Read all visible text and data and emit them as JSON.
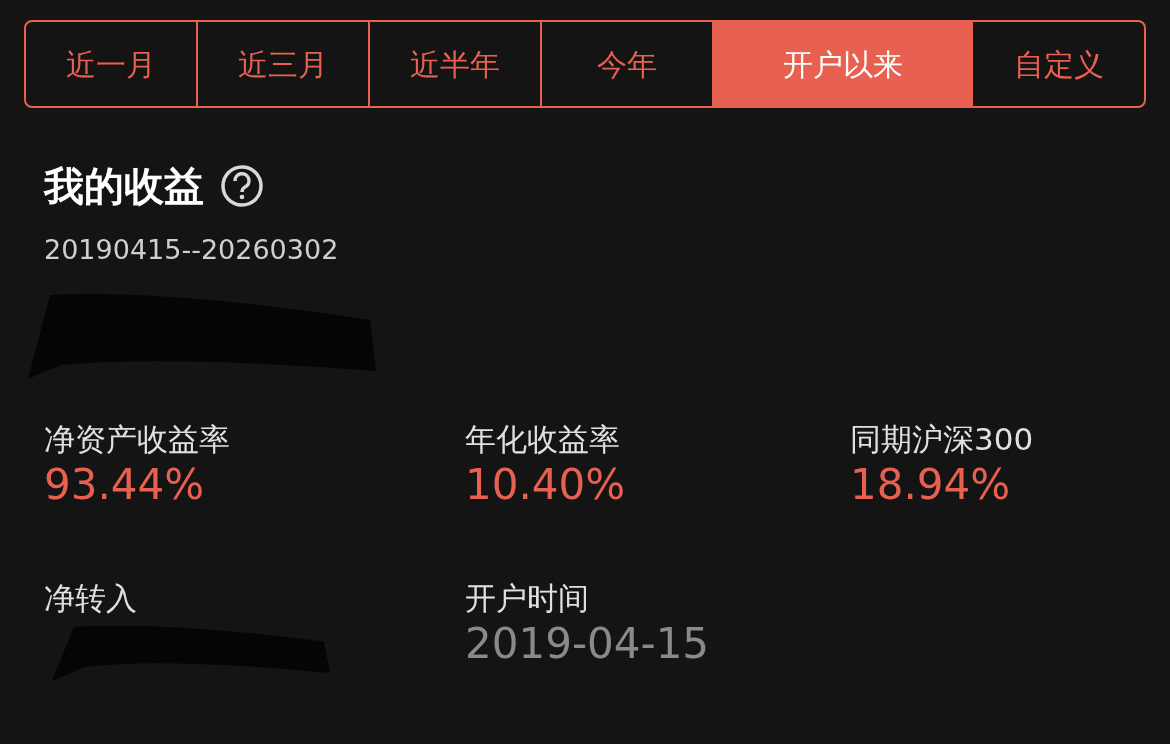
{
  "tabs": [
    {
      "label": "近一月",
      "selected": false
    },
    {
      "label": "近三月",
      "selected": false
    },
    {
      "label": "近半年",
      "selected": false
    },
    {
      "label": "今年",
      "selected": false
    },
    {
      "label": "开户以来",
      "selected": true
    },
    {
      "label": "自定义",
      "selected": false
    }
  ],
  "title": "我的收益",
  "date_range": "20190415--20260302",
  "total": {
    "redacted": true
  },
  "metrics": [
    {
      "label": "净资产收益率",
      "value": "93.44%",
      "kind": "rate"
    },
    {
      "label": "年化收益率",
      "value": "10.40%",
      "kind": "rate"
    },
    {
      "label": "同期沪深300",
      "value": "18.94%",
      "kind": "rate"
    },
    {
      "label": "净转入",
      "redacted": true,
      "kind": "amount"
    },
    {
      "label": "开户时间",
      "value": "2019-04-15",
      "kind": "date"
    }
  ]
}
